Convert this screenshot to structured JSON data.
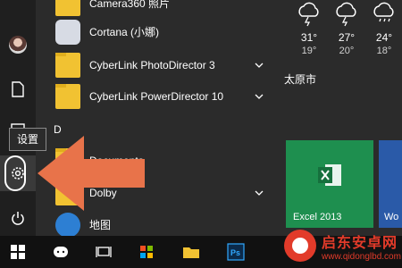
{
  "tooltip": "设置",
  "group_letter": "D",
  "apps": [
    {
      "label": "Camera360 照片",
      "icon": "camera-app-icon"
    },
    {
      "label": "Cortana (小娜)",
      "icon": "cortana-icon"
    },
    {
      "label": "CyberLink PhotoDirector 3",
      "icon": "folder-icon",
      "expandable": true
    },
    {
      "label": "CyberLink PowerDirector 10",
      "icon": "folder-icon",
      "expandable": true
    },
    {
      "label": "Documents",
      "icon": "folder-icon"
    },
    {
      "label": "Dolby",
      "icon": "folder-icon",
      "expandable": true
    },
    {
      "label": "地图",
      "icon": "maps-icon"
    }
  ],
  "weather": {
    "days": [
      {
        "high": "31°",
        "low": "19°"
      },
      {
        "high": "27°",
        "low": "20°"
      },
      {
        "high": "24°",
        "low": "18°"
      }
    ],
    "city": "太原市"
  },
  "tiles": {
    "excel": "Excel 2013",
    "word": "Wo"
  },
  "watermark": {
    "title": "启东安卓网",
    "url": "www.qidonglbd.com"
  },
  "colors": {
    "arrow": "#e8734a",
    "excel_tile": "#1e8f4f",
    "word_tile": "#2a5aa8"
  }
}
